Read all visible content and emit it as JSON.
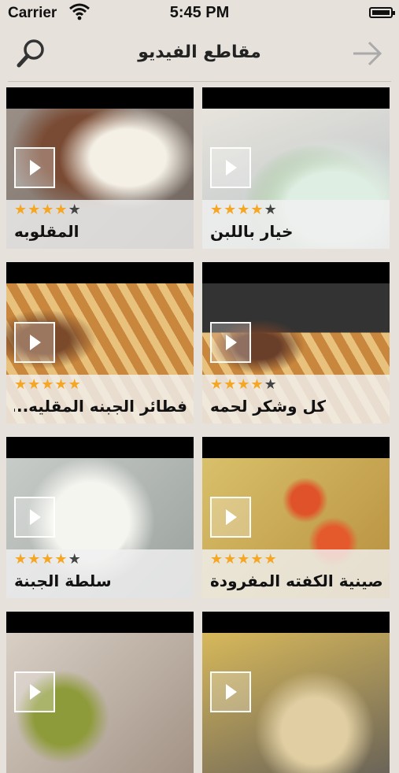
{
  "status_bar": {
    "carrier": "Carrier",
    "time": "5:45 PM"
  },
  "nav": {
    "title": "مقاطع الفيديو"
  },
  "videos": [
    {
      "title": "المقلوبه",
      "rating": 4,
      "max_rating": 5
    },
    {
      "title": "خيار باللبن",
      "rating": 4,
      "max_rating": 5
    },
    {
      "title": "فطائر الجبنه المقليه...",
      "rating": 5,
      "max_rating": 5
    },
    {
      "title": "كل وشكر لحمه",
      "rating": 4,
      "max_rating": 5
    },
    {
      "title": "سلطة الجبنة",
      "rating": 4,
      "max_rating": 5
    },
    {
      "title": "صينية الكفته المفرودة",
      "rating": 5,
      "max_rating": 5
    },
    {
      "title": "",
      "rating": 0,
      "max_rating": 5
    },
    {
      "title": "",
      "rating": 0,
      "max_rating": 5
    }
  ],
  "colors": {
    "star_on": "#f5a623",
    "star_off": "#444444",
    "background": "#e6e2db"
  }
}
